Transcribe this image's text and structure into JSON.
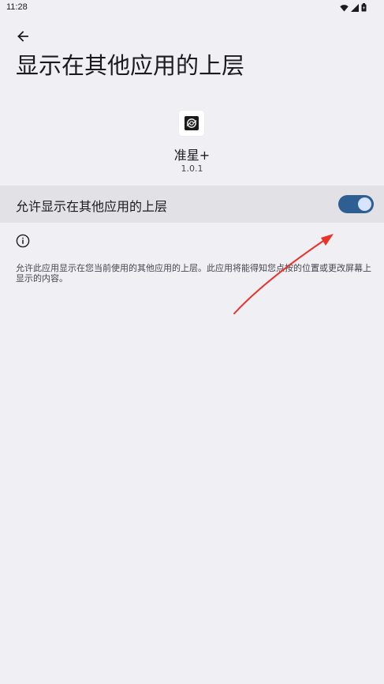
{
  "status_bar": {
    "time": "11:28",
    "icons": [
      "wifi-icon",
      "signal-icon",
      "battery-icon"
    ]
  },
  "header": {
    "back_icon": "arrow-back-icon",
    "title": "显示在其他应用的上层"
  },
  "app": {
    "icon": "target-app-icon",
    "name": "准星+",
    "version": "1.0.1"
  },
  "permission": {
    "label": "允许显示在其他应用的上层",
    "enabled": true
  },
  "info": {
    "icon": "info-icon",
    "text": "允许此应用显示在您当前使用的其他应用的上层。此应用将能得知您点按的位置或更改屏幕上显示的内容。"
  },
  "colors": {
    "background": "#f0eff4",
    "toggle_row": "#e2e1e6",
    "toggle_track": "#2d5f93",
    "toggle_thumb": "#d6e4ff",
    "annotation_arrow": "#e8322a"
  }
}
